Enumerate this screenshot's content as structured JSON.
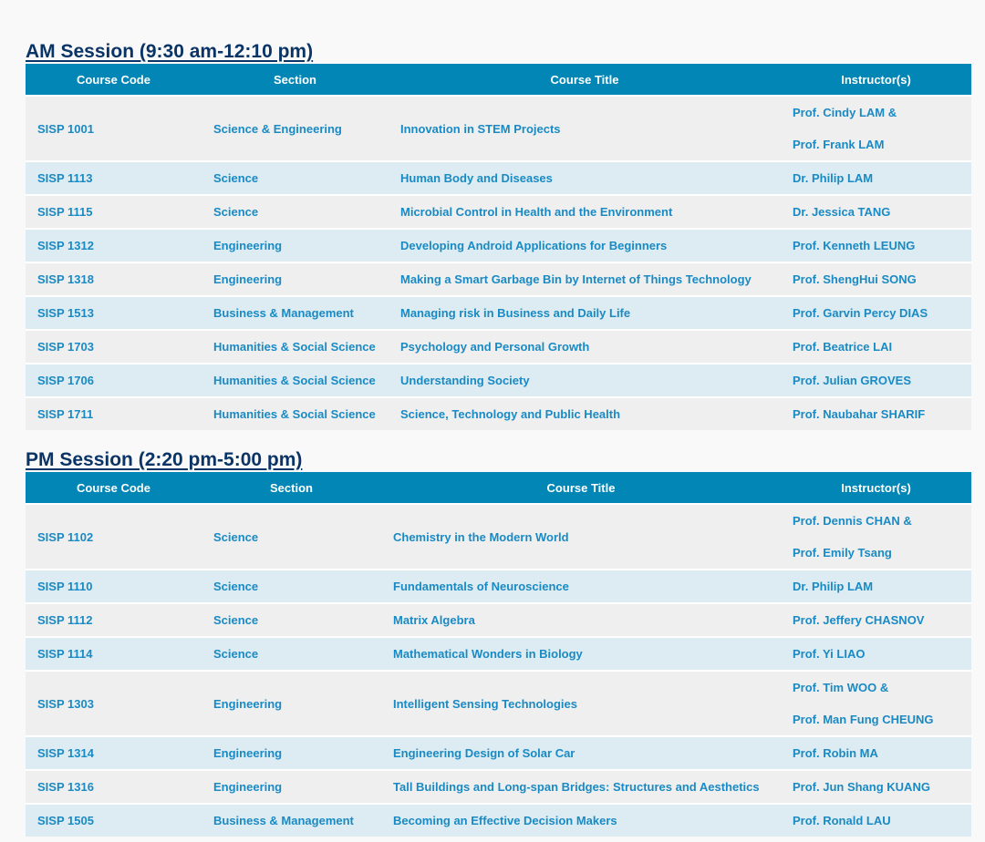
{
  "headers": {
    "code": "Course Code",
    "section": "Section",
    "title": "Course Title",
    "instructors": "Instructor(s)"
  },
  "sessions": [
    {
      "id": "am",
      "heading": "AM Session (9:30 am-12:10 pm)",
      "rows": [
        {
          "code": "SISP 1001",
          "section": "Science & Engineering",
          "title": "Innovation in STEM Projects",
          "instructors": [
            "Prof. Cindy LAM &",
            "Prof. Frank LAM"
          ]
        },
        {
          "code": "SISP 1113",
          "section": "Science",
          "title": "Human Body and Diseases",
          "instructors": [
            "Dr. Philip LAM"
          ]
        },
        {
          "code": "SISP 1115",
          "section": "Science",
          "title": "Microbial Control in Health and the Environment",
          "instructors": [
            "Dr. Jessica TANG"
          ]
        },
        {
          "code": "SISP 1312",
          "section": "Engineering",
          "title": "Developing Android Applications for Beginners",
          "instructors": [
            "Prof. Kenneth LEUNG"
          ]
        },
        {
          "code": "SISP 1318",
          "section": "Engineering",
          "title": "Making a Smart Garbage Bin by Internet of Things Technology",
          "instructors": [
            "Prof. ShengHui SONG"
          ]
        },
        {
          "code": "SISP 1513",
          "section": "Business & Management",
          "title": "Managing risk in Business and Daily Life",
          "instructors": [
            "Prof. Garvin Percy DIAS"
          ]
        },
        {
          "code": "SISP 1703",
          "section": "Humanities & Social Science",
          "title": "Psychology and Personal Growth",
          "instructors": [
            "Prof. Beatrice LAI"
          ]
        },
        {
          "code": "SISP 1706",
          "section": "Humanities & Social Science",
          "title": "Understanding Society",
          "instructors": [
            "Prof. Julian GROVES"
          ]
        },
        {
          "code": "SISP 1711",
          "section": "Humanities & Social Science",
          "title": "Science, Technology and Public Health",
          "instructors": [
            "Prof. Naubahar SHARIF"
          ]
        }
      ]
    },
    {
      "id": "pm",
      "heading": "PM Session (2:20 pm-5:00 pm)",
      "rows": [
        {
          "code": "SISP 1102",
          "section": "Science",
          "title": "Chemistry in the Modern World",
          "instructors": [
            "Prof. Dennis CHAN &",
            "Prof. Emily Tsang"
          ]
        },
        {
          "code": "SISP 1110",
          "section": "Science",
          "title": "Fundamentals of Neuroscience",
          "instructors": [
            "Dr. Philip LAM"
          ]
        },
        {
          "code": "SISP 1112",
          "section": "Science",
          "title": "Matrix Algebra",
          "instructors": [
            "Prof. Jeffery CHASNOV"
          ]
        },
        {
          "code": "SISP 1114",
          "section": "Science",
          "title": "Mathematical Wonders in Biology",
          "instructors": [
            "Prof. Yi LIAO"
          ]
        },
        {
          "code": "SISP 1303",
          "section": "Engineering",
          "title": "Intelligent Sensing Technologies",
          "instructors": [
            "Prof. Tim WOO &",
            "Prof. Man Fung CHEUNG"
          ]
        },
        {
          "code": "SISP 1314",
          "section": "Engineering",
          "title": "Engineering Design of Solar Car",
          "instructors": [
            "Prof. Robin MA"
          ]
        },
        {
          "code": "SISP 1316",
          "section": "Engineering",
          "title": "Tall Buildings and Long-span Bridges: Structures and Aesthetics",
          "instructors": [
            "Prof. Jun Shang KUANG"
          ]
        },
        {
          "code": "SISP 1505",
          "section": "Business & Management",
          "title": "Becoming an Effective Decision Makers",
          "instructors": [
            "Prof. Ronald LAU"
          ]
        }
      ]
    }
  ]
}
